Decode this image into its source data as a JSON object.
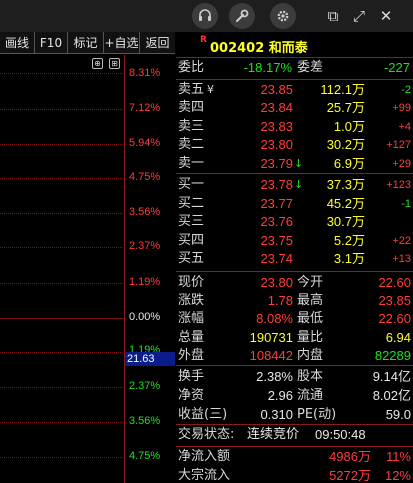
{
  "colors": {
    "up": "#ff3c3c",
    "down": "#20e020",
    "neutral": "#e8e8e8",
    "highlight": "#ffff30",
    "grid": "#7a1010"
  },
  "toolbar": {
    "icons": [
      "headset-icon",
      "wrench-icon",
      "gear-icon"
    ],
    "window": {
      "restore": "⧉",
      "maximize": "⤢",
      "minimize": "—",
      "close": "✕"
    }
  },
  "tabs": [
    "画线",
    "F10",
    "标记",
    "+自选",
    "返回"
  ],
  "chart": {
    "controls": [
      "⊕",
      "⊞"
    ],
    "pct_up": [
      "8.31%",
      "7.12%",
      "5.94%",
      "4.75%",
      "3.56%",
      "2.37%",
      "1.19%"
    ],
    "pct_zero": "0.00%",
    "pct_down": [
      "1.19%",
      "2.37%",
      "3.56%",
      "4.75%"
    ],
    "cursor_value": "21.63"
  },
  "stock": {
    "badge": "R",
    "code_name": "002402 和而泰"
  },
  "weibi": {
    "label1": "委比",
    "ratio": "-18.17%",
    "label2": "委差",
    "diff": "-227"
  },
  "asks": [
    {
      "label": "卖五",
      "mark": "¥",
      "price": "23.85",
      "vol": "112.1万",
      "chg": "-2",
      "arrow": ""
    },
    {
      "label": "卖四",
      "mark": "",
      "price": "23.84",
      "vol": "25.7万",
      "chg": "+99",
      "arrow": ""
    },
    {
      "label": "卖三",
      "mark": "",
      "price": "23.83",
      "vol": "1.0万",
      "chg": "+4",
      "arrow": ""
    },
    {
      "label": "卖二",
      "mark": "",
      "price": "23.80",
      "vol": "30.2万",
      "chg": "+127",
      "arrow": ""
    },
    {
      "label": "卖一",
      "mark": "",
      "price": "23.79",
      "vol": "6.9万",
      "chg": "+29",
      "arrow": "↓"
    }
  ],
  "bids": [
    {
      "label": "买一",
      "price": "23.78",
      "vol": "37.3万",
      "chg": "+123",
      "arrow": "↓"
    },
    {
      "label": "买二",
      "price": "23.77",
      "vol": "45.2万",
      "chg": "-1",
      "arrow": ""
    },
    {
      "label": "买三",
      "price": "23.76",
      "vol": "30.7万",
      "chg": "",
      "arrow": ""
    },
    {
      "label": "买四",
      "price": "23.75",
      "vol": "5.2万",
      "chg": "+22",
      "arrow": ""
    },
    {
      "label": "买五",
      "price": "23.74",
      "vol": "3.1万",
      "chg": "+13",
      "arrow": ""
    }
  ],
  "quote": [
    {
      "l1": "现价",
      "v1": "23.80",
      "c1": "red",
      "l2": "今开",
      "v2": "22.60",
      "c2": "red"
    },
    {
      "l1": "涨跌",
      "v1": "1.78",
      "c1": "red",
      "l2": "最高",
      "v2": "23.85",
      "c2": "red"
    },
    {
      "l1": "涨幅",
      "v1": "8.08%",
      "c1": "red",
      "l2": "最低",
      "v2": "22.60",
      "c2": "red"
    },
    {
      "l1": "总量",
      "v1": "190731",
      "c1": "yellow",
      "l2": "量比",
      "v2": "6.94",
      "c2": "yellow"
    },
    {
      "l1": "外盘",
      "v1": "108442",
      "c1": "red",
      "l2": "内盘",
      "v2": "82289",
      "c2": "green"
    }
  ],
  "fund": [
    {
      "l1": "换手",
      "v1": "2.38%",
      "l2": "股本",
      "v2": "9.14亿"
    },
    {
      "l1": "净资",
      "v1": "2.96",
      "l2": "流通",
      "v2": "8.02亿"
    },
    {
      "l1": "收益(三)",
      "v1": "0.310",
      "l2": "PE(动)",
      "v2": "59.0"
    }
  ],
  "status": {
    "label": "交易状态:",
    "value": "连续竞价",
    "time": "09:50:48"
  },
  "flow": [
    {
      "label": "净流入额",
      "value": "4986万",
      "pct": "11%"
    },
    {
      "label": "大宗流入",
      "value": "5272万",
      "pct": "12%"
    }
  ]
}
